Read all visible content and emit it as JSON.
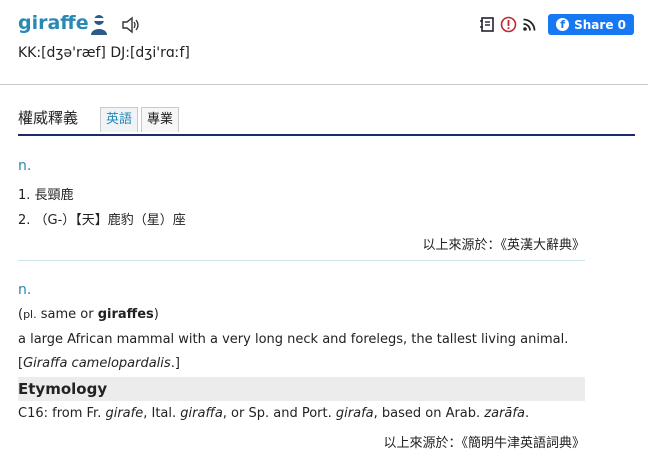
{
  "header": {
    "word": "giraffe",
    "phonetic": "KK:[dʒə'ræf] DJ:[dʒi'rɑːf]",
    "share_label": "Share 0"
  },
  "tabs": {
    "title": "權威釋義",
    "items": [
      {
        "label": "英語",
        "active": true
      },
      {
        "label": "專業",
        "active": false
      }
    ]
  },
  "entry1": {
    "pos": "n.",
    "senses": [
      "1. 長頸鹿",
      "2. （G-）【天】鹿豹（星）座"
    ],
    "source": "以上來源於：《英漢大辭典》"
  },
  "entry2": {
    "pos": "n.",
    "plural_prefix": "(",
    "plural_abbr": "pl.",
    "plural_mid": " same or ",
    "plural_word": "giraffes",
    "plural_suffix": ")",
    "definition": "a large African mammal with a very long neck and forelegs, the tallest living animal.",
    "latin_open": "[",
    "latin": "Giraffa camelopardalis",
    "latin_close": ".]",
    "etymology_title": "Etymology",
    "etym_1": "C16: from Fr. ",
    "etym_2": "girafe",
    "etym_3": ", Ital. ",
    "etym_4": "giraffa",
    "etym_5": ", or Sp. and Port. ",
    "etym_6": "girafa",
    "etym_7": ", based on Arab. ",
    "etym_8": "zarāfa",
    "etym_9": ".",
    "source": "以上來源於：《簡明牛津英語詞典》"
  },
  "colors": {
    "accent": "#2a88b4",
    "facebook": "#1877f2",
    "tab_underline": "#1a2b6b"
  },
  "icons": [
    "user-icon",
    "speaker-icon",
    "notebook-icon",
    "report-icon",
    "rss-icon",
    "facebook-icon"
  ]
}
